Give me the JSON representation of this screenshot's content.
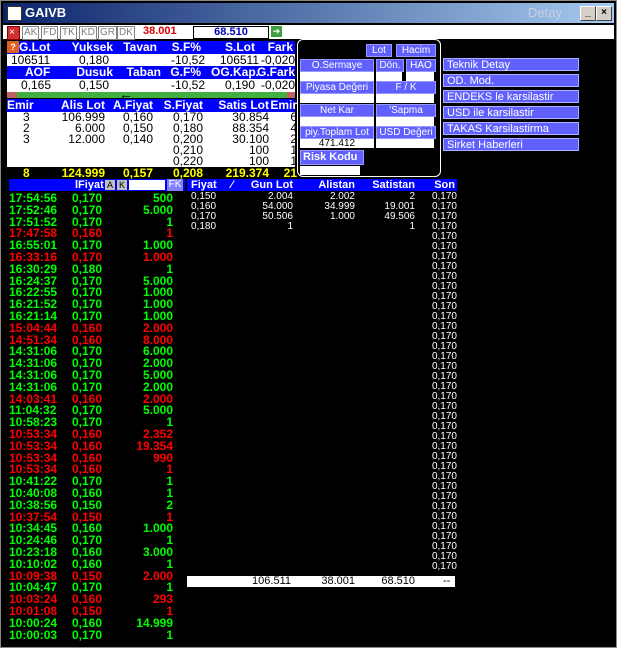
{
  "window": {
    "title": "GAIVB",
    "title_right": "Detay"
  },
  "toolbar": {
    "buttons": [
      "AK",
      "FD",
      "TK",
      "KD",
      "GR",
      "DK"
    ],
    "value_red": "38.001",
    "value_blue": "68.510"
  },
  "summary1": {
    "headers": [
      "G.Lot",
      "Yuksek",
      "Tavan",
      "S.F%",
      "S.Lot",
      "Fark"
    ],
    "values": [
      "106511",
      "0,180",
      "",
      "-10,52",
      "106511",
      "-0,020"
    ]
  },
  "summary2": {
    "headers": [
      "AOF",
      "Dusuk",
      "Taban",
      "G.F%",
      "OG.Kap.",
      "G.Fark"
    ],
    "values": [
      "0,165",
      "0,150",
      "",
      "-10,52",
      "0,190",
      "-0,020"
    ]
  },
  "depth": {
    "headers": [
      "Emir",
      "Alis Lot",
      "A.Fiyat",
      "S.Fiyat",
      "Satis Lot",
      "Emir"
    ],
    "rows": [
      [
        "3",
        "106.999",
        "0,160",
        "0,170",
        "30.854",
        "6"
      ],
      [
        "2",
        "6.000",
        "0,150",
        "0,180",
        "88.354",
        "4"
      ],
      [
        "3",
        "12.000",
        "0,140",
        "0,200",
        "30.100",
        "2"
      ],
      [
        "",
        "",
        "",
        "0,210",
        "100",
        "1"
      ],
      [
        "",
        "",
        "",
        "0,220",
        "100",
        "1"
      ]
    ],
    "totals": [
      "8",
      "124.999",
      "0,157",
      "0,208",
      "219.374",
      "21"
    ]
  },
  "panel": {
    "lot_label": "Lot",
    "hacim_label": "Hacim",
    "osermaye_label": "O.Sermaye",
    "don_label": "Dön.",
    "hao_label": "HAO",
    "piyasa_label": "Piyasa Değeri",
    "fk_label": "F / K",
    "netkar_label": "Net Kar",
    "sapma_label": "'Sapma",
    "piy_toplam_label": "piy.Toplam Lot",
    "piy_toplam_value": "471.412",
    "usd_label": "USD Değeri",
    "risk_label": "Risk Kodu"
  },
  "menu": [
    "Teknik Detay",
    "OD. Mod.",
    "ENDEKS le karsilastir",
    "USD ile karsilastir",
    "TAKAS Karsilastirma",
    "Sirket Haberleri"
  ],
  "trades_header": {
    "fiyat": "lFiyat",
    "a": "A",
    "k": "K",
    "fk": "FK"
  },
  "trades": [
    [
      "17:54:56",
      "0,170",
      "500",
      "g"
    ],
    [
      "17:52:46",
      "0,170",
      "5.000",
      "g"
    ],
    [
      "17:51:52",
      "0,170",
      "1",
      "g"
    ],
    [
      "17:47:58",
      "0,160",
      "1",
      "r"
    ],
    [
      "16:55:01",
      "0,170",
      "1.000",
      "g"
    ],
    [
      "16:33:16",
      "0,170",
      "1.000",
      "r"
    ],
    [
      "16:30:29",
      "0,180",
      "1",
      "g"
    ],
    [
      "16:24:37",
      "0,170",
      "5.000",
      "g"
    ],
    [
      "16:22:55",
      "0,170",
      "1.000",
      "g"
    ],
    [
      "16:21:52",
      "0,170",
      "1.000",
      "g"
    ],
    [
      "16:21:14",
      "0,170",
      "1.000",
      "g"
    ],
    [
      "15:04:44",
      "0,160",
      "2.000",
      "r"
    ],
    [
      "14:51:34",
      "0,160",
      "8.000",
      "r"
    ],
    [
      "14:31:06",
      "0,170",
      "6.000",
      "g"
    ],
    [
      "14:31:06",
      "0,170",
      "2.000",
      "g"
    ],
    [
      "14:31:06",
      "0,170",
      "5.000",
      "g"
    ],
    [
      "14:31:06",
      "0,170",
      "2.000",
      "g"
    ],
    [
      "14:03:41",
      "0,160",
      "2.000",
      "r"
    ],
    [
      "11:04:32",
      "0,170",
      "5.000",
      "g"
    ],
    [
      "10:58:23",
      "0,170",
      "1",
      "g"
    ],
    [
      "10:53:34",
      "0,160",
      "2.352",
      "r"
    ],
    [
      "10:53:34",
      "0,160",
      "19.354",
      "r"
    ],
    [
      "10:53:34",
      "0,160",
      "990",
      "r"
    ],
    [
      "10:53:34",
      "0,160",
      "1",
      "r"
    ],
    [
      "10:41:22",
      "0,170",
      "1",
      "g"
    ],
    [
      "10:40:08",
      "0,160",
      "1",
      "g"
    ],
    [
      "10:38:56",
      "0,150",
      "2",
      "g"
    ],
    [
      "10:37:54",
      "0,150",
      "1",
      "r"
    ],
    [
      "10:34:45",
      "0,160",
      "1.000",
      "g"
    ],
    [
      "10:24:46",
      "0,170",
      "1",
      "g"
    ],
    [
      "10:23:18",
      "0,160",
      "3.000",
      "g"
    ],
    [
      "10:10:02",
      "0,160",
      "1",
      "g"
    ],
    [
      "10:09:38",
      "0,150",
      "2.000",
      "r"
    ],
    [
      "10:04:47",
      "0,170",
      "1",
      "g"
    ],
    [
      "10:03:24",
      "0,160",
      "293",
      "r"
    ],
    [
      "10:01:08",
      "0,150",
      "1",
      "r"
    ],
    [
      "10:00:24",
      "0,160",
      "14.999",
      "g"
    ],
    [
      "10:00:03",
      "0,170",
      "1",
      "g"
    ]
  ],
  "dist_header": [
    "Fiyat",
    "Gun Lot",
    "Alistan",
    "Satistan",
    "Son"
  ],
  "dist_rows": [
    [
      "0,150",
      "2.004",
      "2.002",
      "2"
    ],
    [
      "0,160",
      "54.000",
      "34.999",
      "19.001"
    ],
    [
      "0,170",
      "50.506",
      "1.000",
      "49.506"
    ],
    [
      "0,180",
      "1",
      "",
      "1"
    ]
  ],
  "son_value": "0,170",
  "son_count": 38,
  "dist_totals": [
    "106.511",
    "38.001",
    "68.510",
    "--"
  ]
}
